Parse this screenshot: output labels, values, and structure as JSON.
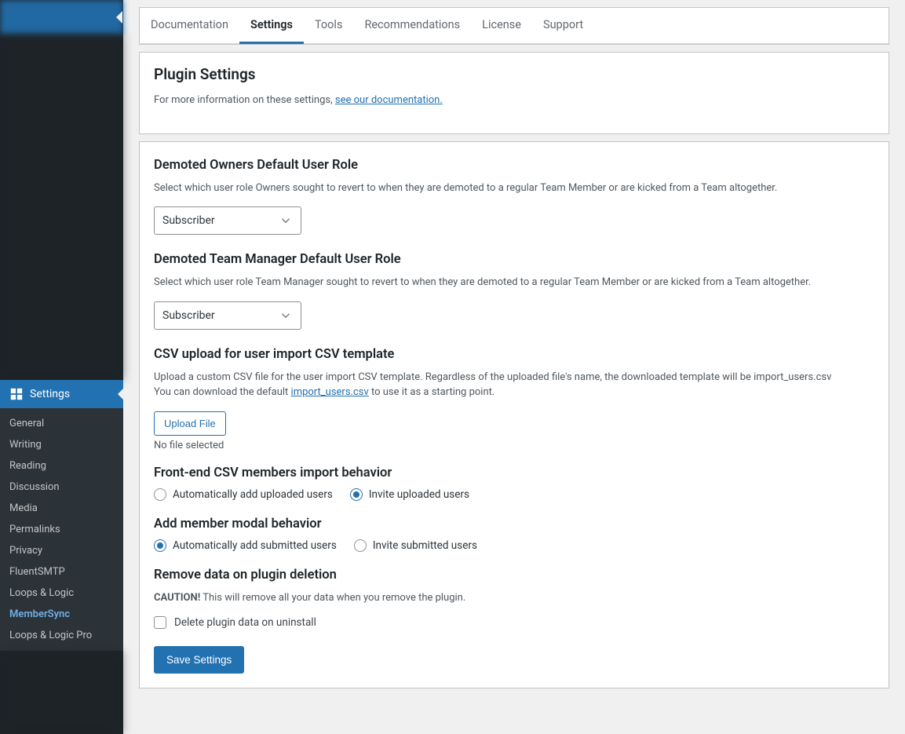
{
  "sidebar": {
    "active_label": "Settings",
    "sub": [
      "General",
      "Writing",
      "Reading",
      "Discussion",
      "Media",
      "Permalinks",
      "Privacy",
      "FluentSMTP",
      "Loops & Logic",
      "MemberSync",
      "Loops & Logic Pro"
    ],
    "current_index": 9
  },
  "tabs": [
    "Documentation",
    "Settings",
    "Tools",
    "Recommendations",
    "License",
    "Support"
  ],
  "active_tab": 1,
  "intro": {
    "heading": "Plugin Settings",
    "text": "For more information on these settings, ",
    "link": "see our documentation."
  },
  "sections": {
    "demoted_owners": {
      "heading": "Demoted Owners Default User Role",
      "desc": "Select which user role Owners sought to revert to when they are demoted to a regular Team Member or are kicked from a Team altogether.",
      "value": "Subscriber"
    },
    "demoted_manager": {
      "heading": "Demoted Team Manager Default User Role",
      "desc": "Select which user role Team Manager sought to revert to when they are demoted to a regular Team Member or are kicked from a Team altogether.",
      "value": "Subscriber"
    },
    "csv_upload": {
      "heading": "CSV upload for user import CSV template",
      "desc1": "Upload a custom CSV file for the user import CSV template. Regardless of the uploaded file's name, the downloaded template will be import_users.csv",
      "desc2a": "You can download the default ",
      "desc2_link": "import_users.csv",
      "desc2b": " to use it as a starting point.",
      "button": "Upload File",
      "status": "No file selected"
    },
    "frontend_csv": {
      "heading": "Front-end CSV members import behavior",
      "opt1": "Automatically add uploaded users",
      "opt2": "Invite uploaded users"
    },
    "add_modal": {
      "heading": "Add member modal behavior",
      "opt1": "Automatically add submitted users",
      "opt2": "Invite submitted users"
    },
    "remove_data": {
      "heading": "Remove data on plugin deletion",
      "caution": "CAUTION!",
      "desc": " This will remove all your data when you remove the plugin.",
      "checkbox_label": "Delete plugin data on uninstall"
    }
  },
  "save_label": "Save Settings"
}
